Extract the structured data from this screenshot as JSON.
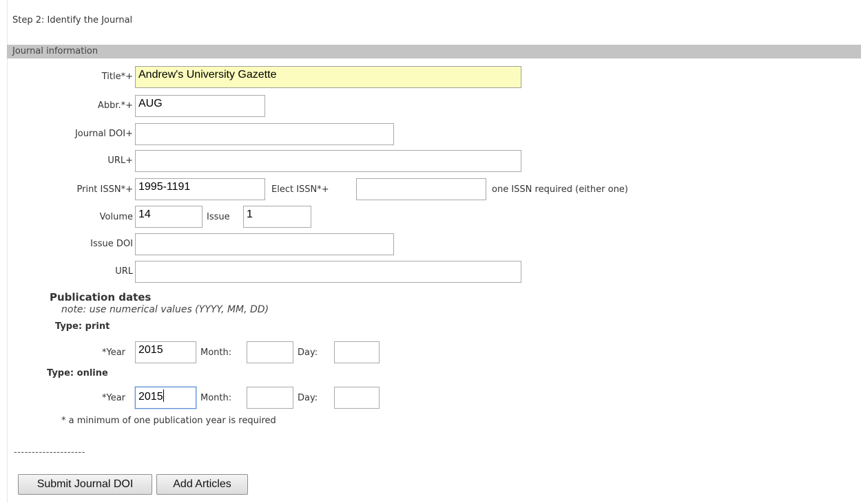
{
  "step_title": "Step 2: Identify the Journal",
  "section_title": "Journal information",
  "fields": {
    "title": {
      "label": "Title*+",
      "value": "Andrew's University Gazette"
    },
    "abbr": {
      "label": "Abbr.*+",
      "value": "AUG"
    },
    "journal_doi": {
      "label": "Journal DOI+",
      "value": ""
    },
    "journal_url": {
      "label": "URL+",
      "value": ""
    },
    "print_issn": {
      "label": "Print ISSN*+",
      "value": "1995-1191"
    },
    "elect_issn": {
      "label": "Elect ISSN*+",
      "value": ""
    },
    "issn_note": "one ISSN required (either one)",
    "volume": {
      "label": "Volume",
      "value": "14"
    },
    "issue": {
      "label": "Issue",
      "value": "1"
    },
    "issue_doi": {
      "label": "Issue DOI",
      "value": ""
    },
    "issue_url": {
      "label": "URL",
      "value": ""
    }
  },
  "publication_dates": {
    "heading": "Publication dates",
    "note": "note: use numerical values (YYYY, MM, DD)",
    "print": {
      "type_label": "Type: print",
      "year_label": "*Year",
      "year_value": "2015",
      "month_label": "Month:",
      "month_value": "",
      "day_label": "Day:",
      "day_value": ""
    },
    "online": {
      "type_label": "Type: online",
      "year_label": "*Year",
      "year_value": "2015",
      "month_label": "Month:",
      "month_value": "",
      "day_label": "Day:",
      "day_value": ""
    },
    "requirement_note": "* a minimum of one publication year is required"
  },
  "separator": "--------------------",
  "buttons": {
    "submit": "Submit Journal DOI",
    "add_articles": "Add Articles"
  },
  "colors": {
    "section_bar": "#c4c4c4",
    "highlight_field": "#fcfcbe",
    "focus_border": "#5b8fd8"
  }
}
